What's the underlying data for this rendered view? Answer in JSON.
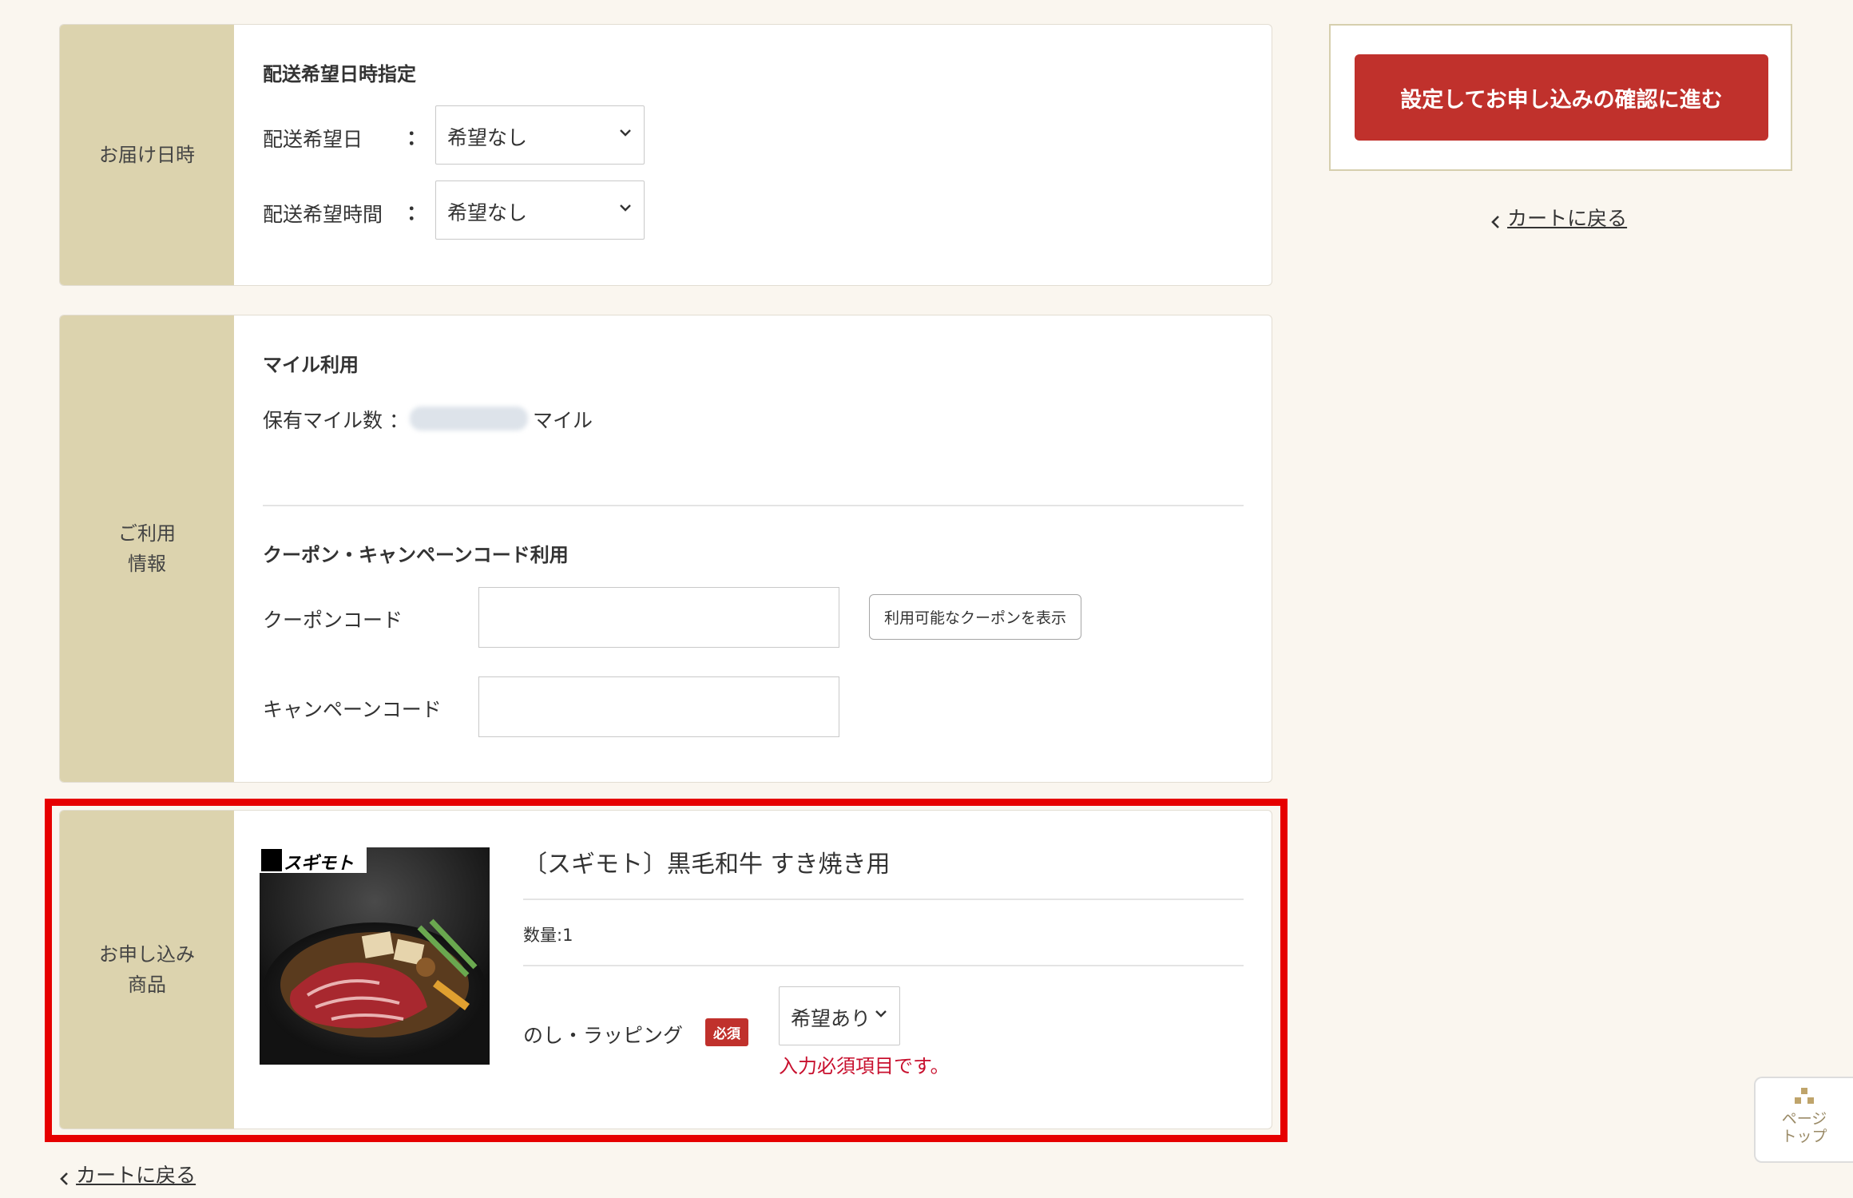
{
  "delivery": {
    "section_label": "お届け日時",
    "title": "配送希望日時指定",
    "date_label": "配送希望日",
    "date_colon": "：",
    "date_value": "希望なし",
    "time_label": "配送希望時間",
    "time_colon": "：",
    "time_value": "希望なし"
  },
  "usage": {
    "section_label_line1": "ご利用",
    "section_label_line2": "情報",
    "mile_title": "マイル利用",
    "mile_label": "保有マイル数 ：",
    "mile_unit": "マイル",
    "coupon_title": "クーポン・キャンペーンコード利用",
    "coupon_label": "クーポンコード",
    "coupon_value": "",
    "show_coupons_button": "利用可能なクーポンを表示",
    "campaign_label": "キャンペーンコード",
    "campaign_value": ""
  },
  "order": {
    "section_label_line1": "お申し込み",
    "section_label_line2": "商品",
    "brand_logo_text": "スギモト",
    "product_name": "〔スギモト〕黒毛和牛 すき焼き用",
    "quantity": "数量:1",
    "wrapping_label": "のし・ラッピング",
    "required_badge": "必須",
    "wrapping_value": "希望あり",
    "error_message": "入力必須項目です。"
  },
  "sidebar": {
    "proceed_button": "設定してお申し込みの確認に進む",
    "back_to_cart": "カートに戻る"
  },
  "footer": {
    "back_to_cart": "カートに戻る"
  },
  "page_top": {
    "line1": "ページ",
    "line2": "トップ"
  },
  "colors": {
    "accent_red": "#c0312c",
    "label_bg": "#dcd3ae",
    "page_bg": "#faf6ef",
    "highlight_border": "#e60000",
    "error_text": "#c8102e"
  }
}
